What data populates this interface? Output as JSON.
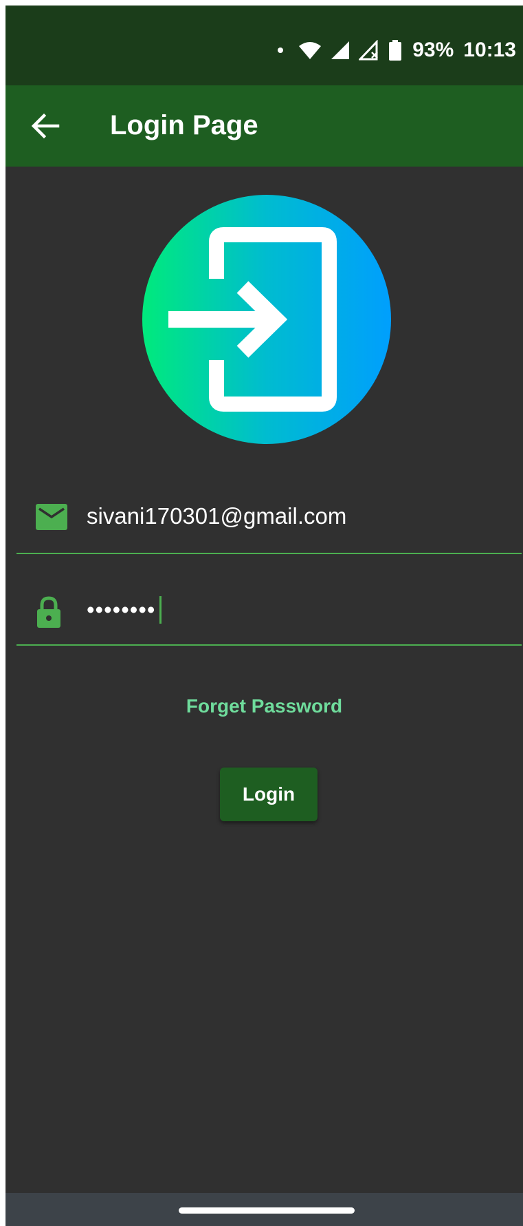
{
  "status_bar": {
    "battery": "93%",
    "time": "10:13",
    "icons": [
      "notification-dot",
      "wifi-icon",
      "signal-icon",
      "signal-no-sim-icon",
      "battery-icon"
    ]
  },
  "app_bar": {
    "title": "Login Page",
    "back_icon": "arrow-back-icon",
    "color": "#1e5e21"
  },
  "logo": {
    "icon": "login-enter-icon",
    "gradient": [
      "#00ea7c",
      "#009ffd"
    ]
  },
  "form": {
    "email": {
      "icon": "email-icon",
      "value": "sivani170301@gmail.com"
    },
    "password": {
      "icon": "lock-icon",
      "value": "••••••••"
    },
    "accent_color": "#4caf50"
  },
  "forget_password_label": "Forget Password",
  "login_label": "Login",
  "colors": {
    "background": "#303030",
    "status_bar": "#1b3d1a",
    "link": "#6fdc9c"
  }
}
